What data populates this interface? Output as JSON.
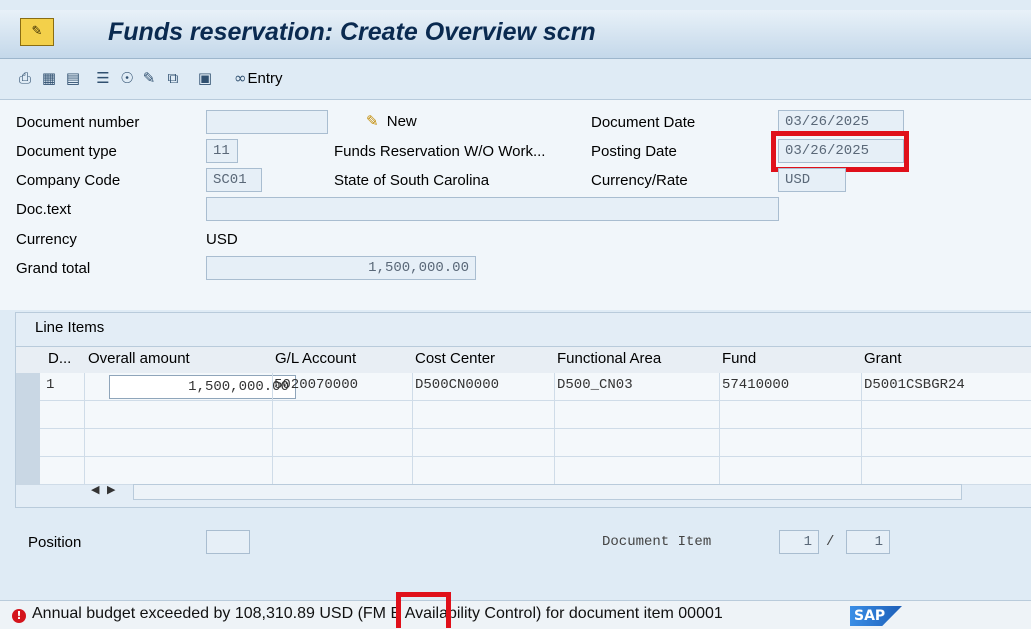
{
  "window": {
    "title": "Funds reservation: Create Overview scrn",
    "app_icon": "sap-transaction-icon"
  },
  "toolbar": {
    "icons": [
      "print-icon",
      "overview-icon",
      "document-icon",
      "list-icon",
      "hierarchy-icon",
      "edit-icon",
      "copy-icon",
      "delete-icon"
    ],
    "entry_label": "Entry"
  },
  "header": {
    "document_number": {
      "label": "Document number",
      "value": ""
    },
    "new_label": "New",
    "document_type": {
      "label": "Document type",
      "value": "11",
      "description": "Funds Reservation W/O Work..."
    },
    "company_code": {
      "label": "Company Code",
      "value": "SC01",
      "description": "State of South Carolina"
    },
    "doc_text": {
      "label": "Doc.text",
      "value": ""
    },
    "currency": {
      "label": "Currency",
      "value": "USD"
    },
    "grand_total": {
      "label": "Grand total",
      "value": "1,500,000.00"
    },
    "document_date": {
      "label": "Document Date",
      "value": "03/26/2025"
    },
    "posting_date": {
      "label": "Posting Date",
      "value": "03/26/2025"
    },
    "currency_rate": {
      "label": "Currency/Rate",
      "value": "USD"
    }
  },
  "line_items": {
    "title": "Line Items",
    "columns": [
      "D...",
      "Overall amount",
      "G/L Account",
      "Cost Center",
      "Functional Area",
      "Fund",
      "Grant"
    ],
    "rows": [
      {
        "d": "1",
        "amount": "1,500,000.00",
        "gl_account": "5020070000",
        "cost_center": "D500CN0000",
        "functional_area": "D500_CN03",
        "fund": "57410000",
        "grant": "D5001CSBGR24"
      }
    ]
  },
  "footer": {
    "position_label": "Position",
    "position_value": "",
    "document_item_label": "Document Item",
    "document_item_current": "1",
    "document_item_separator": "/",
    "document_item_total": "1"
  },
  "status": {
    "type": "error",
    "message": "Annual budget exceeded by 108,310.89 USD (FM  B Availability Control) for document item 00001",
    "logo": "SAP"
  },
  "colors": {
    "highlight": "#e0101a",
    "title": "#0a2a50"
  }
}
